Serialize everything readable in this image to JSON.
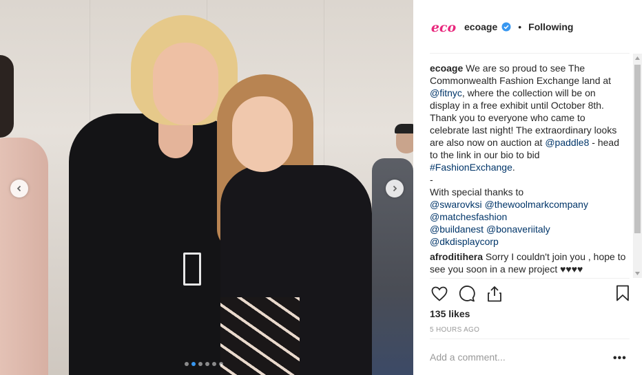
{
  "post": {
    "username": "ecoage",
    "follow_state": "Following",
    "bullet": "•",
    "logo_text": "eco",
    "likes": "135 likes",
    "time_ago": "5 HOURS AGO",
    "add_comment_placeholder": "Add a comment...",
    "more_label": "•••",
    "icons": [
      "heart-icon",
      "comment-icon",
      "share-icon",
      "bookmark-icon",
      "verified-badge-icon"
    ]
  },
  "carousel": {
    "total": 6,
    "current": 2
  },
  "caption": {
    "user": "ecoage",
    "t1": "We are so proud to see The Commonwealth Fashion Exchange land at ",
    "mention_fitnyc": "@fitnyc",
    "t2": ", where the collection will be on display in a free exhibit until October 8th. Thank you to everyone who came to celebrate last night! The extraordinary looks are also now on auction at ",
    "mention_paddle8": "@paddle8",
    "t3": " - head to the link in our bio to bid ",
    "hashtag": "#FashionExchange",
    "t4": ".",
    "dash": "-",
    "thanks": "With special thanks to",
    "m_swarovksi": "@swarovksi",
    "m_woolmark": "@thewoolmarkcompany",
    "m_matches": "@matchesfashion",
    "m_buildanest": "@buildanest",
    "m_bonaveri": "@bonaveriitaly",
    "m_dkdisplay": "@dkdisplaycorp"
  },
  "comment1": {
    "user": "afroditihera",
    "text": "Sorry I couldn't join you , hope to see you soon in a new project ♥♥♥♥"
  },
  "colors": {
    "link": "#003569",
    "accent": "#3897f0",
    "logo_pink": "#e8287d"
  }
}
